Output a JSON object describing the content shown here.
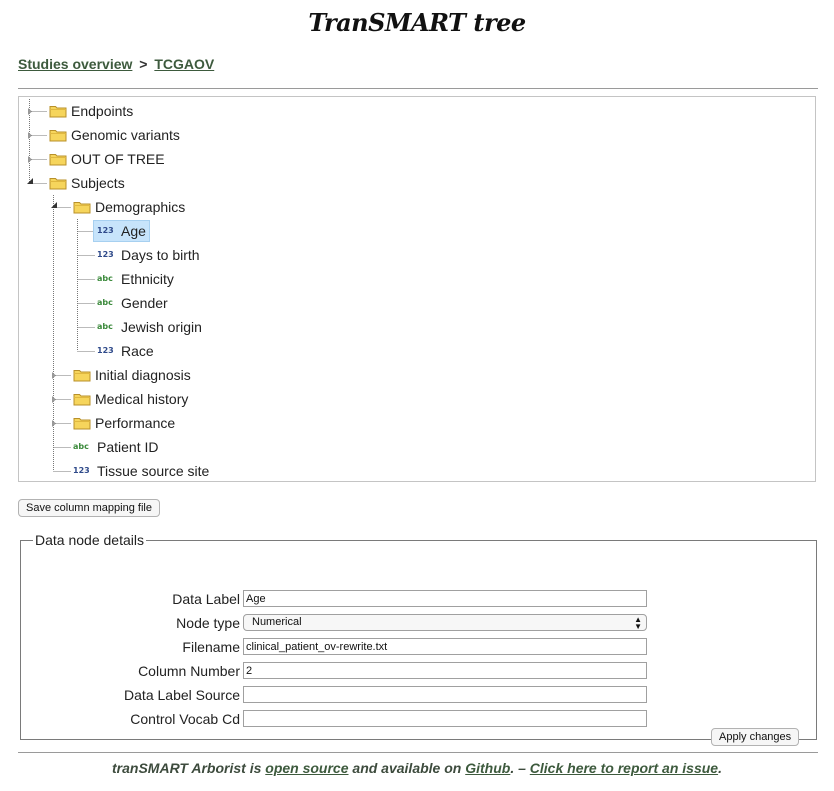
{
  "header": {
    "title": "TranSMART tree"
  },
  "breadcrumb": {
    "studies": "Studies overview",
    "separator": ">",
    "study": "TCGAOV"
  },
  "tree": {
    "nodes": [
      {
        "label": "Endpoints",
        "kind": "folder"
      },
      {
        "label": "Genomic variants",
        "kind": "folder"
      },
      {
        "label": "OUT OF TREE",
        "kind": "folder"
      },
      {
        "label": "Subjects",
        "kind": "folder"
      },
      {
        "label": "Demographics",
        "kind": "folder"
      },
      {
        "label": "Age",
        "kind": "numeric",
        "type_tag": "123",
        "selected": true
      },
      {
        "label": "Days to birth",
        "kind": "numeric",
        "type_tag": "123"
      },
      {
        "label": "Ethnicity",
        "kind": "categorical",
        "type_tag": "abc"
      },
      {
        "label": "Gender",
        "kind": "categorical",
        "type_tag": "abc"
      },
      {
        "label": "Jewish origin",
        "kind": "categorical",
        "type_tag": "abc"
      },
      {
        "label": "Race",
        "kind": "numeric",
        "type_tag": "123"
      },
      {
        "label": "Initial diagnosis",
        "kind": "folder"
      },
      {
        "label": "Medical history",
        "kind": "folder"
      },
      {
        "label": "Performance",
        "kind": "folder"
      },
      {
        "label": "Patient ID",
        "kind": "categorical",
        "type_tag": "abc"
      },
      {
        "label": "Tissue source site",
        "kind": "numeric",
        "type_tag": "123"
      }
    ]
  },
  "buttons": {
    "save_mapping": "Save column mapping file",
    "apply_changes": "Apply changes"
  },
  "details": {
    "legend": "Data node details",
    "fields": [
      {
        "label": "Data Label",
        "value": "Age"
      },
      {
        "label": "Node type",
        "value": "Numerical"
      },
      {
        "label": "Filename",
        "value": "clinical_patient_ov-rewrite.txt"
      },
      {
        "label": "Column Number",
        "value": "2"
      },
      {
        "label": "Data Label Source",
        "value": ""
      },
      {
        "label": "Control Vocab Cd",
        "value": ""
      }
    ]
  },
  "footer": {
    "part1": "tranSMART Arborist is ",
    "open_source": "open source",
    "part2": " and available on ",
    "github": "Github",
    "part3": ". – ",
    "report": "Click here to report an issue",
    "part4": "."
  },
  "colors": {
    "link": "#3d5a3d",
    "selection": "#c7e4fb",
    "folder": "#f6d55c",
    "numeric_tag": "#2f4a8a",
    "categorical_tag": "#3b8a3b"
  },
  "icons": {
    "folder": "folder-icon",
    "numeric": "numeric-type-icon",
    "categorical": "categorical-type-icon"
  }
}
